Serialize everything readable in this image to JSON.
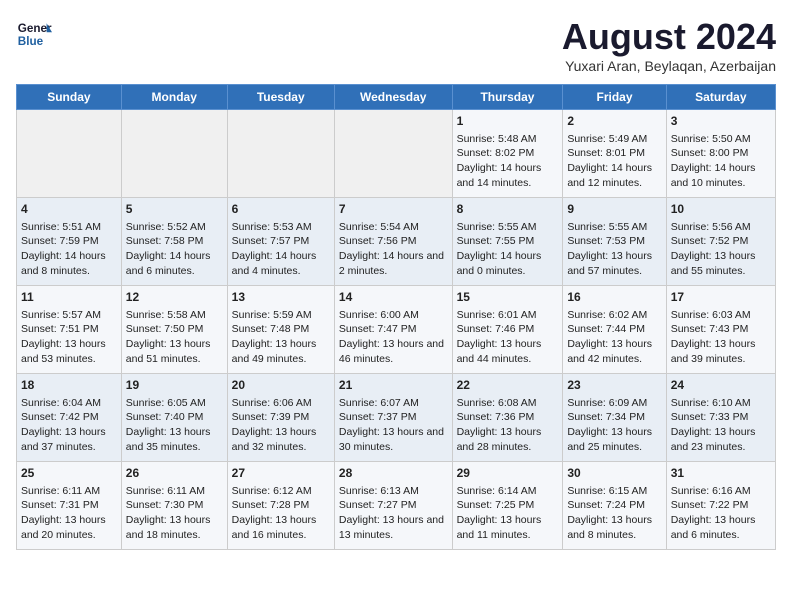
{
  "header": {
    "logo_line1": "General",
    "logo_line2": "Blue",
    "title": "August 2024",
    "subtitle": "Yuxari Aran, Beylaqan, Azerbaijan"
  },
  "columns": [
    "Sunday",
    "Monday",
    "Tuesday",
    "Wednesday",
    "Thursday",
    "Friday",
    "Saturday"
  ],
  "weeks": [
    [
      {
        "day": "",
        "content": ""
      },
      {
        "day": "",
        "content": ""
      },
      {
        "day": "",
        "content": ""
      },
      {
        "day": "",
        "content": ""
      },
      {
        "day": "1",
        "content": "Sunrise: 5:48 AM\nSunset: 8:02 PM\nDaylight: 14 hours and 14 minutes."
      },
      {
        "day": "2",
        "content": "Sunrise: 5:49 AM\nSunset: 8:01 PM\nDaylight: 14 hours and 12 minutes."
      },
      {
        "day": "3",
        "content": "Sunrise: 5:50 AM\nSunset: 8:00 PM\nDaylight: 14 hours and 10 minutes."
      }
    ],
    [
      {
        "day": "4",
        "content": "Sunrise: 5:51 AM\nSunset: 7:59 PM\nDaylight: 14 hours and 8 minutes."
      },
      {
        "day": "5",
        "content": "Sunrise: 5:52 AM\nSunset: 7:58 PM\nDaylight: 14 hours and 6 minutes."
      },
      {
        "day": "6",
        "content": "Sunrise: 5:53 AM\nSunset: 7:57 PM\nDaylight: 14 hours and 4 minutes."
      },
      {
        "day": "7",
        "content": "Sunrise: 5:54 AM\nSunset: 7:56 PM\nDaylight: 14 hours and 2 minutes."
      },
      {
        "day": "8",
        "content": "Sunrise: 5:55 AM\nSunset: 7:55 PM\nDaylight: 14 hours and 0 minutes."
      },
      {
        "day": "9",
        "content": "Sunrise: 5:55 AM\nSunset: 7:53 PM\nDaylight: 13 hours and 57 minutes."
      },
      {
        "day": "10",
        "content": "Sunrise: 5:56 AM\nSunset: 7:52 PM\nDaylight: 13 hours and 55 minutes."
      }
    ],
    [
      {
        "day": "11",
        "content": "Sunrise: 5:57 AM\nSunset: 7:51 PM\nDaylight: 13 hours and 53 minutes."
      },
      {
        "day": "12",
        "content": "Sunrise: 5:58 AM\nSunset: 7:50 PM\nDaylight: 13 hours and 51 minutes."
      },
      {
        "day": "13",
        "content": "Sunrise: 5:59 AM\nSunset: 7:48 PM\nDaylight: 13 hours and 49 minutes."
      },
      {
        "day": "14",
        "content": "Sunrise: 6:00 AM\nSunset: 7:47 PM\nDaylight: 13 hours and 46 minutes."
      },
      {
        "day": "15",
        "content": "Sunrise: 6:01 AM\nSunset: 7:46 PM\nDaylight: 13 hours and 44 minutes."
      },
      {
        "day": "16",
        "content": "Sunrise: 6:02 AM\nSunset: 7:44 PM\nDaylight: 13 hours and 42 minutes."
      },
      {
        "day": "17",
        "content": "Sunrise: 6:03 AM\nSunset: 7:43 PM\nDaylight: 13 hours and 39 minutes."
      }
    ],
    [
      {
        "day": "18",
        "content": "Sunrise: 6:04 AM\nSunset: 7:42 PM\nDaylight: 13 hours and 37 minutes."
      },
      {
        "day": "19",
        "content": "Sunrise: 6:05 AM\nSunset: 7:40 PM\nDaylight: 13 hours and 35 minutes."
      },
      {
        "day": "20",
        "content": "Sunrise: 6:06 AM\nSunset: 7:39 PM\nDaylight: 13 hours and 32 minutes."
      },
      {
        "day": "21",
        "content": "Sunrise: 6:07 AM\nSunset: 7:37 PM\nDaylight: 13 hours and 30 minutes."
      },
      {
        "day": "22",
        "content": "Sunrise: 6:08 AM\nSunset: 7:36 PM\nDaylight: 13 hours and 28 minutes."
      },
      {
        "day": "23",
        "content": "Sunrise: 6:09 AM\nSunset: 7:34 PM\nDaylight: 13 hours and 25 minutes."
      },
      {
        "day": "24",
        "content": "Sunrise: 6:10 AM\nSunset: 7:33 PM\nDaylight: 13 hours and 23 minutes."
      }
    ],
    [
      {
        "day": "25",
        "content": "Sunrise: 6:11 AM\nSunset: 7:31 PM\nDaylight: 13 hours and 20 minutes."
      },
      {
        "day": "26",
        "content": "Sunrise: 6:11 AM\nSunset: 7:30 PM\nDaylight: 13 hours and 18 minutes."
      },
      {
        "day": "27",
        "content": "Sunrise: 6:12 AM\nSunset: 7:28 PM\nDaylight: 13 hours and 16 minutes."
      },
      {
        "day": "28",
        "content": "Sunrise: 6:13 AM\nSunset: 7:27 PM\nDaylight: 13 hours and 13 minutes."
      },
      {
        "day": "29",
        "content": "Sunrise: 6:14 AM\nSunset: 7:25 PM\nDaylight: 13 hours and 11 minutes."
      },
      {
        "day": "30",
        "content": "Sunrise: 6:15 AM\nSunset: 7:24 PM\nDaylight: 13 hours and 8 minutes."
      },
      {
        "day": "31",
        "content": "Sunrise: 6:16 AM\nSunset: 7:22 PM\nDaylight: 13 hours and 6 minutes."
      }
    ]
  ]
}
